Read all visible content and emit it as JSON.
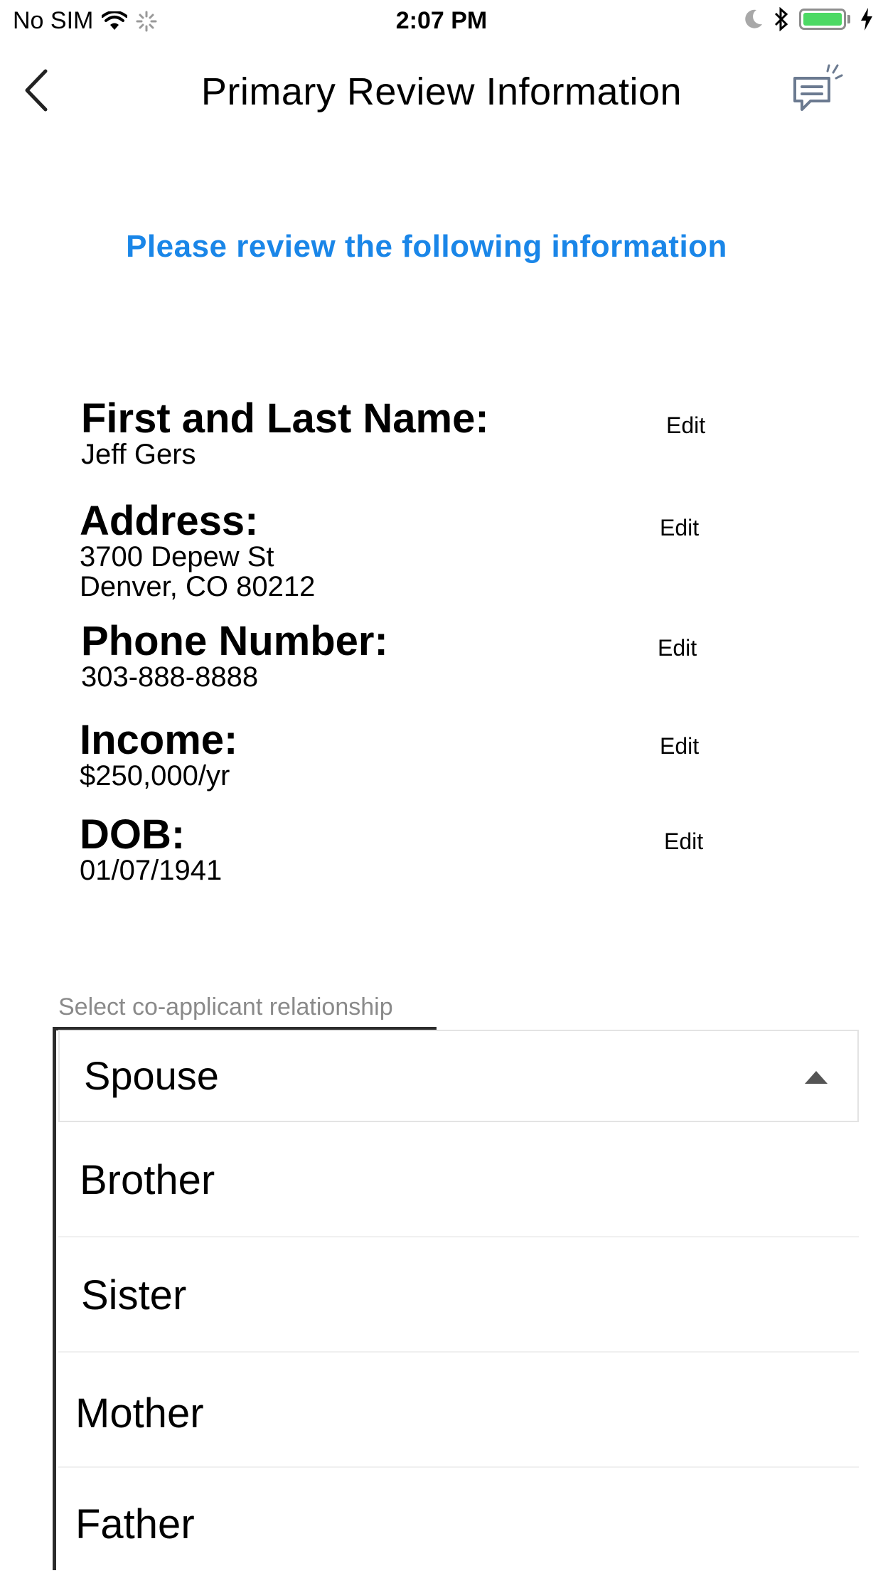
{
  "status_bar": {
    "carrier": "No SIM",
    "time": "2:07 PM",
    "battery_color": "#4cd964"
  },
  "nav": {
    "title": "Primary Review Information",
    "back_icon": "chevron-left-icon",
    "chat_icon": "chat-icon"
  },
  "headline": "Please review the following information",
  "fields": [
    {
      "label": "First and Last Name:",
      "value": "Jeff Gers",
      "edit": "Edit"
    },
    {
      "label": "Address:",
      "value": "3700 Depew St\nDenver, CO 80212",
      "edit": "Edit"
    },
    {
      "label": "Phone Number:",
      "value": "303-888-8888",
      "edit": "Edit"
    },
    {
      "label": "Income:",
      "value": "$250,000/yr",
      "edit": "Edit"
    },
    {
      "label": "DOB:",
      "value": "01/07/1941",
      "edit": "Edit"
    }
  ],
  "relationship": {
    "label": "Select co-applicant relationship",
    "selected": "Spouse",
    "options": [
      "Brother",
      "Sister",
      "Mother",
      "Father"
    ]
  },
  "colors": {
    "accent": "#1a86e8"
  }
}
